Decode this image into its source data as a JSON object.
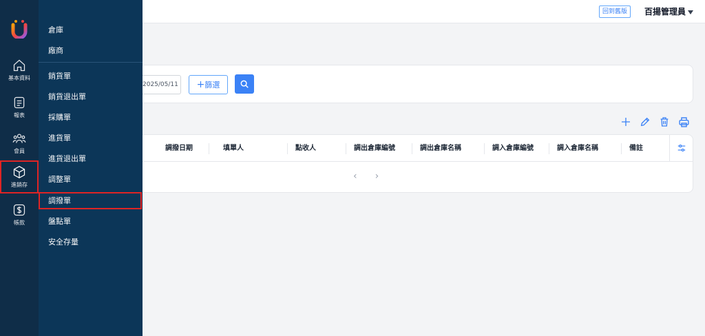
{
  "header": {
    "old_version_label": "回到舊版",
    "user_name": "百揚管理員"
  },
  "rail": [
    {
      "label": "基本資料",
      "icon": "home-icon"
    },
    {
      "label": "報表",
      "icon": "report-icon"
    },
    {
      "label": "會員",
      "icon": "members-icon"
    },
    {
      "label": "進銷存",
      "icon": "box-icon"
    },
    {
      "label": "帳款",
      "icon": "dollar-icon"
    }
  ],
  "flyout": [
    {
      "label": "倉庫"
    },
    {
      "label": "廠商"
    },
    {
      "label": "銷貨單"
    },
    {
      "label": "銷貨退出單"
    },
    {
      "label": "採購單"
    },
    {
      "label": "進貨單"
    },
    {
      "label": "進貨退出單"
    },
    {
      "label": "調整單"
    },
    {
      "label": "調撥單"
    },
    {
      "label": "盤點單"
    },
    {
      "label": "安全存量"
    }
  ],
  "filter": {
    "date_value": "2025/05/11",
    "filter_button_label": "篩選"
  },
  "table": {
    "columns": [
      "調撥日期",
      "填單人",
      "點收人",
      "調出倉庫編號",
      "調出倉庫名稱",
      "調入倉庫編號",
      "調入倉庫名稱",
      "備註"
    ]
  },
  "colors": {
    "rail_bg": "#0f2d48",
    "flyout_bg": "#0c3658",
    "accent": "#3b82f6",
    "highlight_border": "#e02424"
  }
}
